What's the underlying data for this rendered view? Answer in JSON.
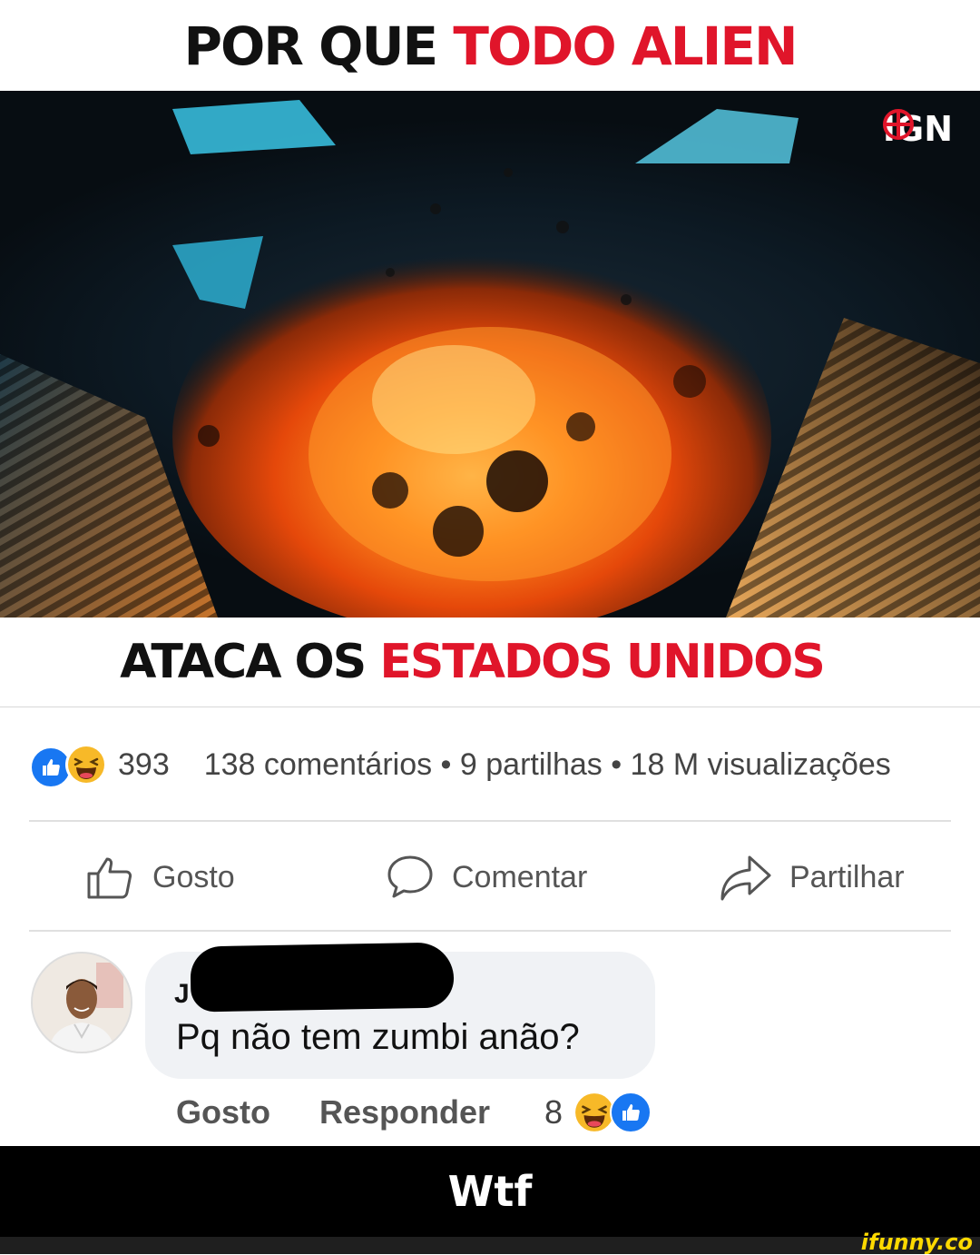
{
  "thumbnail": {
    "top_black": "POR QUE",
    "top_red": "TODO ALIEN",
    "bottom_black": "ATACA OS",
    "bottom_red": "ESTADOS UNIDOS",
    "logo_text": "IGN"
  },
  "stats": {
    "reaction_icons": [
      "like-icon",
      "haha-icon"
    ],
    "reactions_count": "393",
    "details": "138 comentários • 9 partilhas • 18 M visualizações"
  },
  "actions": {
    "like": "Gosto",
    "comment": "Comentar",
    "share": "Partilhar"
  },
  "comment": {
    "author_initial": "J",
    "text": "Pq  não tem zumbi anão?",
    "like": "Gosto",
    "reply": "Responder",
    "reactions_count": "8"
  },
  "caption": "Wtf",
  "watermark": "ifunny.co",
  "colors": {
    "red": "#e0152a",
    "facebook_blue": "#1877f2",
    "watermark_yellow": "#fdd900"
  }
}
